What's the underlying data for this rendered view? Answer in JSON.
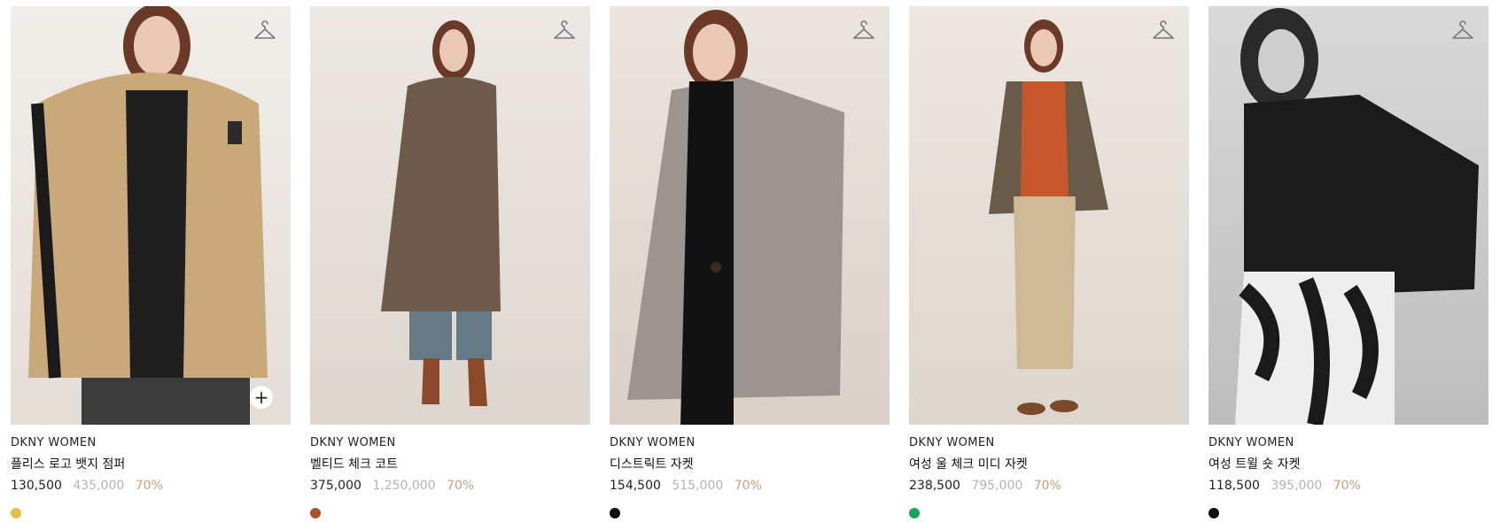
{
  "products": [
    {
      "brand": "DKNY WOMEN",
      "name": "플리스 로고 뱃지 점퍼",
      "sale_price": "130,500",
      "original_price": "435,000",
      "discount": "70%",
      "swatch_color": "#e3c04a",
      "garment_color": "#c9a979",
      "icons": [
        "hanger-icon",
        "plus-icon"
      ]
    },
    {
      "brand": "DKNY WOMEN",
      "name": "벨티드 체크 코트",
      "sale_price": "375,000",
      "original_price": "1,250,000",
      "discount": "70%",
      "swatch_color": "#a5532b",
      "garment_color": "#6e5a4a",
      "icons": [
        "hanger-icon"
      ]
    },
    {
      "brand": "DKNY WOMEN",
      "name": "디스트릭트 자켓",
      "sale_price": "154,500",
      "original_price": "515,000",
      "discount": "70%",
      "swatch_color": "#111111",
      "garment_color": "#9a9590",
      "icons": [
        "hanger-icon"
      ]
    },
    {
      "brand": "DKNY WOMEN",
      "name": "여성 울 체크 미디 자켓",
      "sale_price": "238,500",
      "original_price": "795,000",
      "discount": "70%",
      "swatch_color": "#1aa655",
      "garment_color": "#6a5b48",
      "icons": [
        "hanger-icon"
      ]
    },
    {
      "brand": "DKNY WOMEN",
      "name": "여성 트윌 숏 자켓",
      "sale_price": "118,500",
      "original_price": "395,000",
      "discount": "70%",
      "swatch_color": "#111111",
      "garment_color": "#1b1b1b",
      "icons": [
        "hanger-icon"
      ]
    }
  ],
  "colors": {
    "discount": "#c8a07c",
    "original_price": "#b3b3b3"
  }
}
